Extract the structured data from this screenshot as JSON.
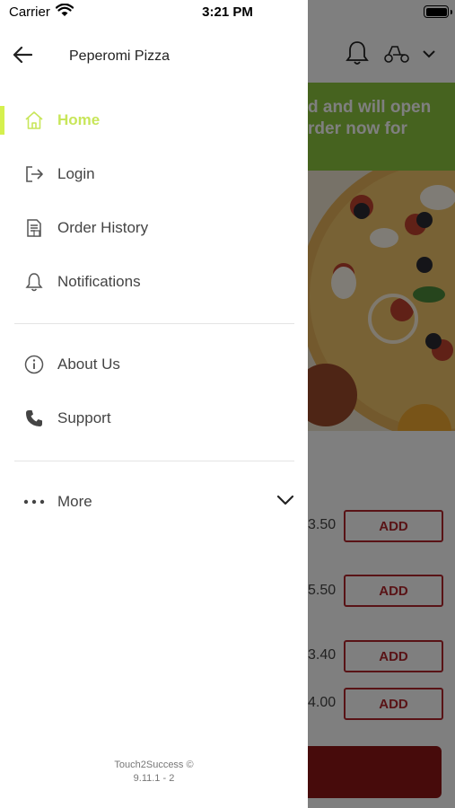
{
  "status_bar": {
    "carrier": "Carrier",
    "time": "3:21 PM"
  },
  "drawer": {
    "title": "Peperomi Pizza",
    "menu": [
      {
        "label": "Home",
        "icon": "home-icon",
        "active": true
      },
      {
        "label": "Login",
        "icon": "login-icon"
      },
      {
        "label": "Order History",
        "icon": "receipt-icon"
      },
      {
        "label": "Notifications",
        "icon": "bell-icon"
      },
      {
        "label": "About Us",
        "icon": "info-icon"
      },
      {
        "label": "Support",
        "icon": "phone-icon"
      },
      {
        "label": "More",
        "icon": "more-dots-icon"
      }
    ],
    "footer_line1": "Touch2Success ©",
    "footer_line2": "9.11.1 - 2"
  },
  "background": {
    "banner_line1": "d and will open",
    "banner_line2": "rder now for",
    "items": [
      {
        "price": "3.50",
        "add_label": "ADD"
      },
      {
        "price": "5.50",
        "add_label": "ADD"
      },
      {
        "price": "3.40",
        "add_label": "ADD"
      },
      {
        "price": "4.00",
        "add_label": "ADD"
      }
    ]
  },
  "colors": {
    "accent": "#d5f04e",
    "banner": "#8cc63f",
    "brand_red": "#b3262c"
  }
}
